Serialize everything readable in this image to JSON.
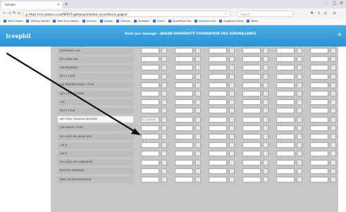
{
  "browser": {
    "tab_title": "Sample",
    "tab_close_icon": "close-icon",
    "new_tab_icon": "new-tab-icon",
    "window_buttons": [
      "minimize-icon",
      "maximize-icon",
      "close-icon"
    ],
    "nav_icons": [
      "back-icon",
      "forward-icon",
      "reload-icon",
      "home-icon"
    ],
    "address": "https://crs.jadeux.co.za/HEROT/gateway/medical_surveillance_page/2",
    "search_placeholder": "Search",
    "toolbar_icons": [
      "bookmark-star-icon",
      "download-icon",
      "home-icon",
      "menu-icon"
    ],
    "bookmarks": [
      "Most Visited",
      "Getting Started",
      "Web Slice Gallery",
      "Internet",
      "Google",
      "Outlook",
      "Facebook",
      "Gmail",
      "SharePoint Site",
      "Intranet Links",
      "Suggested Sites",
      "News"
    ]
  },
  "app": {
    "logo": "Icesphil",
    "title": "Tests you manage - AKRAN UNIVERSITY FOUNDATION EDU SURVEILLANCE",
    "menu_icon": "menu-icon"
  },
  "grid": {
    "rows": [
      {
        "label": "REFERENCE LAB",
        "value": ""
      },
      {
        "label": "NFL LEVEL LAB",
        "value": ""
      },
      {
        "label": "LAB READINGS",
        "value": ""
      },
      {
        "label": "SIGL F FOUR",
        "value": ""
      },
      {
        "label": "LAB INTERNATIONAL F FOUR",
        "value": ""
      },
      {
        "label": "SIGL F FOUR SCORE",
        "value": ""
      },
      {
        "label": "LAB",
        "value": ""
      },
      {
        "label": "SIGL F FOUR",
        "value": ""
      },
      {
        "label": "NFL LEVEL TRIALOGY REVISION",
        "value": "0.1 0.02 0.3"
      },
      {
        "label": "LAB MINOR F FOUR",
        "value": ""
      },
      {
        "label": "NFL LEVEL NIL MEGA SEMI",
        "value": ""
      },
      {
        "label": "LAB 8",
        "value": ""
      },
      {
        "label": "LAB 9",
        "value": ""
      },
      {
        "label": "NFL LEVEL RECOMMENDED",
        "value": ""
      },
      {
        "label": "RESTUDY SEMINARS",
        "value": ""
      },
      {
        "label": "NEW LAB RECOMMENDED",
        "value": ""
      }
    ],
    "highlight_index": 8
  },
  "annotation": {
    "color": "#111111"
  }
}
